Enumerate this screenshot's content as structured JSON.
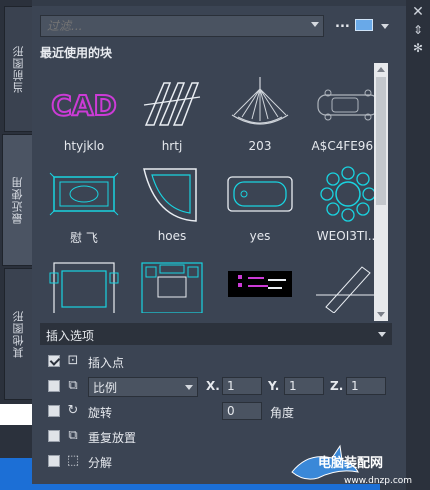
{
  "left_tabs": [
    {
      "label": "当前图形"
    },
    {
      "label": "最近使用"
    },
    {
      "label": "其他图形"
    }
  ],
  "right_bar": {
    "close_label": "✕",
    "pin_label": "⇕",
    "settings_label": "✻"
  },
  "filter": {
    "placeholder": "过滤..."
  },
  "toolbar": {
    "more_label": "..."
  },
  "section_title": "最近使用的块",
  "blocks": [
    {
      "label": "htyjklo"
    },
    {
      "label": "hrtj"
    },
    {
      "label": "203"
    },
    {
      "label": "A$C4FE96..."
    },
    {
      "label": "慰 飞"
    },
    {
      "label": "hoes"
    },
    {
      "label": "yes"
    },
    {
      "label": "WEOI3TI..."
    },
    {
      "label": ""
    },
    {
      "label": ""
    },
    {
      "label": ""
    },
    {
      "label": ""
    }
  ],
  "insert_options": {
    "title": "插入选项",
    "insertion_point": {
      "label": "插入点",
      "checked": true
    },
    "scale": {
      "select_value": "比例",
      "x_label": "X.",
      "x_value": "1",
      "y_label": "Y.",
      "y_value": "1",
      "z_label": "Z.",
      "z_value": "1",
      "checked": false
    },
    "rotation": {
      "label": "旋转",
      "angle_value": "0",
      "angle_label": "角度",
      "checked": false
    },
    "repeat": {
      "label": "重复放置",
      "checked": false
    },
    "explode": {
      "label": "分解",
      "checked": false
    }
  },
  "watermark": {
    "text": "电脑装配网",
    "sub": "www.dnzp.com"
  },
  "colors": {
    "panel_bg": "#3b4453",
    "accent_blue": "#1c6fd6",
    "thumb_magenta": "#cc3bd6",
    "thumb_cyan": "#19d3e0"
  }
}
